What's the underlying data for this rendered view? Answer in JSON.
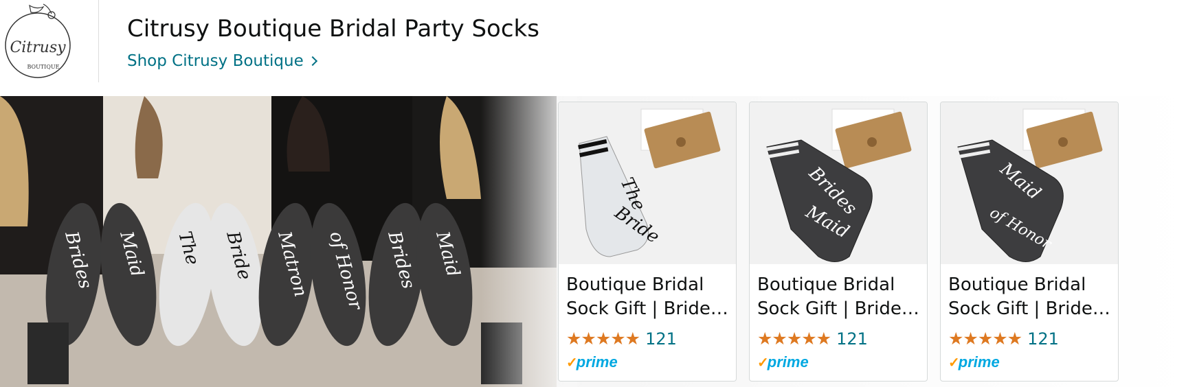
{
  "brand": {
    "logo_text": "Citrusy",
    "logo_subtext": "BOUTIQUE",
    "title": "Citrusy Boutique Bridal Party Socks",
    "shop_link": "Shop Citrusy Boutique"
  },
  "hero": {
    "sock_texts": [
      "Brides",
      "Maid",
      "The",
      "Bride",
      "Matron",
      "of Honor",
      "Brides",
      "Maid"
    ]
  },
  "products": [
    {
      "title": "Boutique Bridal Sock Gift | Bride…",
      "rating_count": "121",
      "prime": "prime",
      "sock_line1": "The",
      "sock_line2": "Bride",
      "sock_color": "#e4e7ea"
    },
    {
      "title": "Boutique Bridal Sock Gift | Bride…",
      "rating_count": "121",
      "prime": "prime",
      "sock_line1": "Brides",
      "sock_line2": "Maid",
      "sock_color": "#3d3d3f"
    },
    {
      "title": "Boutique Bridal Sock Gift | Bride…",
      "rating_count": "121",
      "prime": "prime",
      "sock_line1": "Maid",
      "sock_line2": "of Honor",
      "sock_color": "#3d3d3f"
    }
  ],
  "colors": {
    "link": "#007185",
    "star": "#de7921",
    "prime": "#00a8e1"
  }
}
